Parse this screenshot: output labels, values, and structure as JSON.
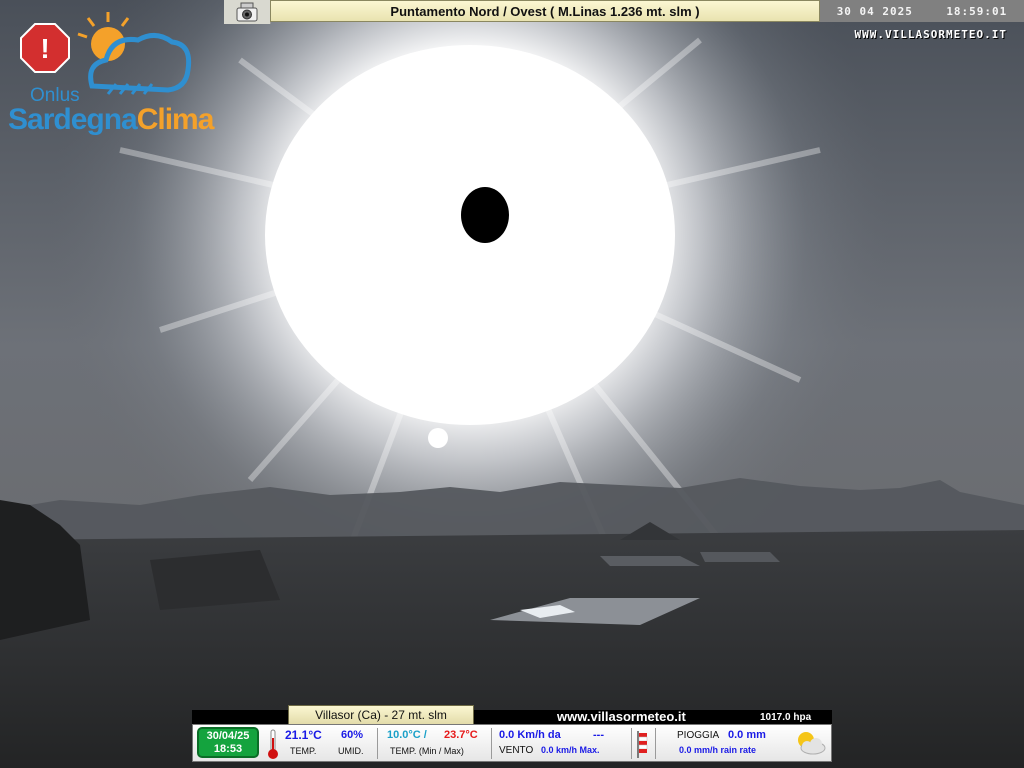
{
  "header": {
    "title": "Puntamento Nord / Ovest ( M.Linas 1.236 mt.  slm )",
    "date": "30 04 2025",
    "time": "18:59:01",
    "site": "WWW.VILLASORMETEO.IT",
    "camera_icon": "webcam-icon"
  },
  "logo": {
    "line1": "Onlus",
    "name_part1": "Sardegna",
    "name_part2": "Clima",
    "icon": "sun-cloud-rain-logo",
    "colors": {
      "blue": "#2f8fd0",
      "orange": "#f4a12a",
      "red": "#d32f2f"
    }
  },
  "weather_panel": {
    "location": "Villasor (Ca) -  27 mt. slm",
    "site": "www.villasormeteo.it",
    "pressure": "1017.0  hpa",
    "date": "30/04/25",
    "time": "18:53",
    "temperature": "21.1°C",
    "temperature_label": "TEMP.",
    "humidity": "60%",
    "humidity_label": "UMID.",
    "temp_min": "10.0°C /",
    "temp_max": "23.7°C",
    "minmax_label": "TEMP. (Min / Max)",
    "wind": "0.0 Km/h da",
    "wind_dir": "---",
    "wind_label": "VENTO",
    "wind_max": "0.0  km/h Max.",
    "rain_label": "PIOGGIA",
    "rain": "0.0 mm",
    "rain_rate": "0.0 mm/h rain rate",
    "icons": [
      "thermometer-icon",
      "windsock-icon",
      "partly-cloudy-icon"
    ]
  }
}
